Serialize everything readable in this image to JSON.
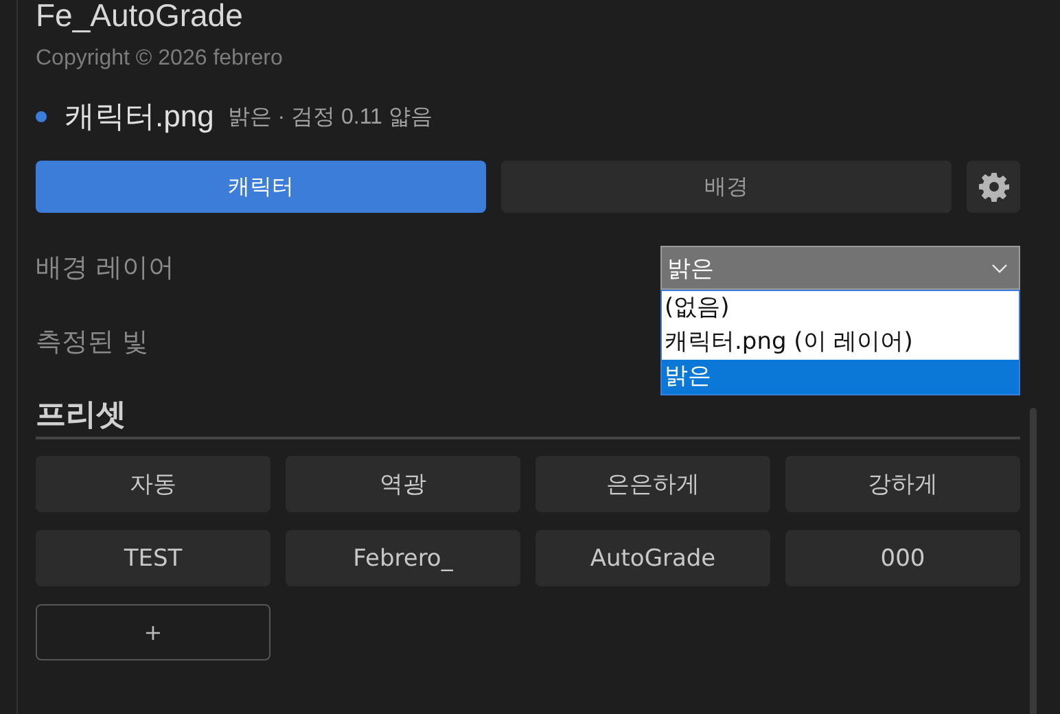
{
  "app": {
    "title": "Fe_AutoGrade",
    "copyright": "Copyright © 2026 febrero"
  },
  "layer": {
    "name": "캐릭터.png",
    "color": "#3b7dd8",
    "info": "밝은 · 검정 0.11 얇음"
  },
  "tabs": [
    {
      "label": "캐릭터",
      "selected": true
    },
    {
      "label": "배경",
      "selected": false
    }
  ],
  "fields": [
    {
      "label": "배경 레이어",
      "kind": "dropdown",
      "value": "밝은",
      "expanded": true,
      "options": [
        {
          "label": "(없음)",
          "selected": false
        },
        {
          "label": "캐릭터.png  (이 레이어)",
          "selected": false
        },
        {
          "label": "밝은",
          "selected": true
        }
      ]
    },
    {
      "label": "측정된 빛",
      "kind": "readout"
    }
  ],
  "presets": {
    "title": "프리셋",
    "items": [
      "자동",
      "역광",
      "은은하게",
      "강하게",
      "TEST",
      "Febrero_",
      "AutoGrade",
      "000"
    ],
    "add_label": "+"
  }
}
